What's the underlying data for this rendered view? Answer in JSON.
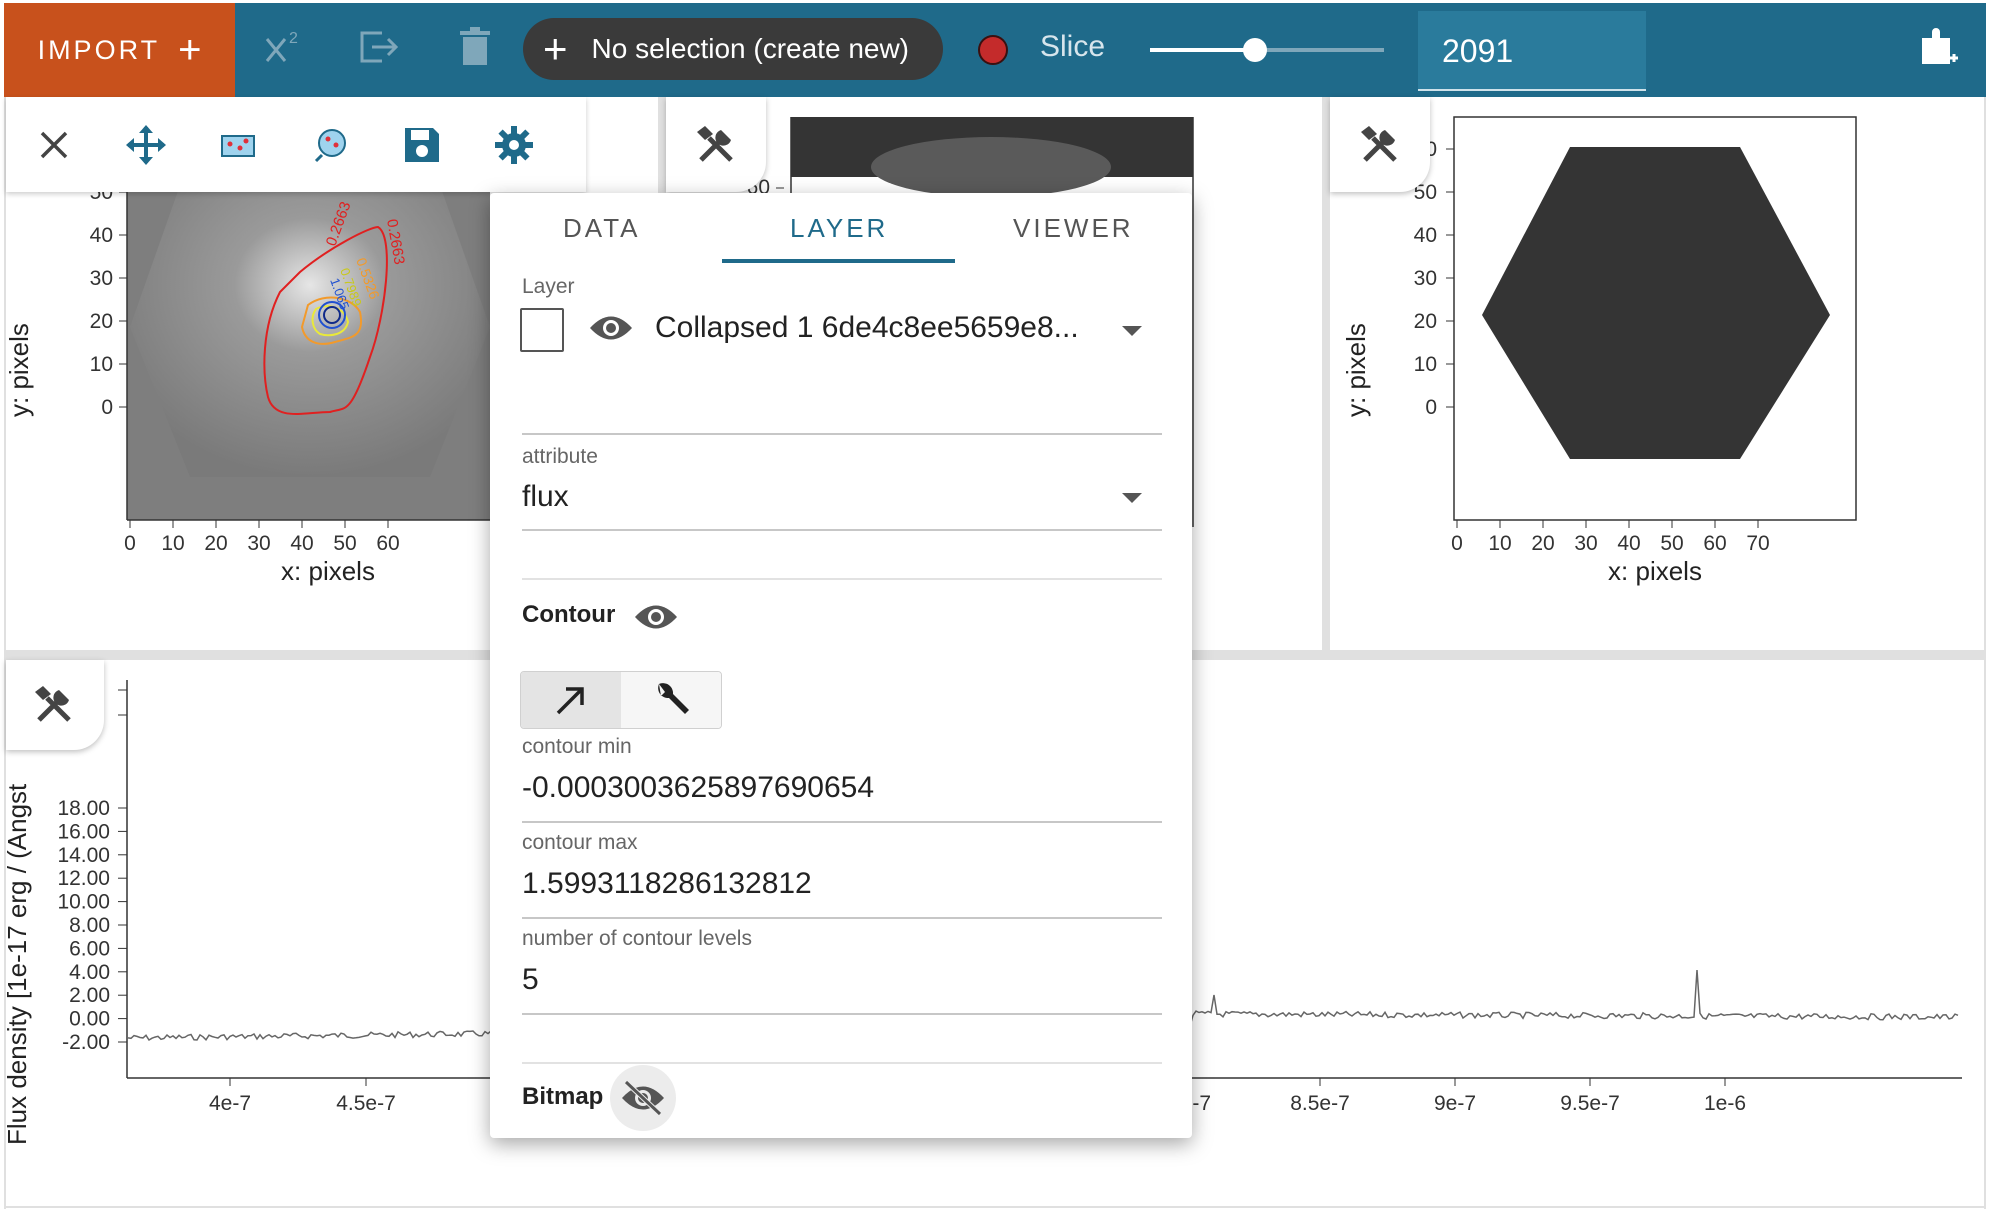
{
  "toolbar": {
    "import_label": "IMPORT",
    "subset_label": "No selection (create new)",
    "slice_label": "Slice",
    "slice_value": "2091",
    "slider_fraction": 0.45
  },
  "image_viewer_1": {
    "x_label": "x: pixels",
    "y_label": "y: pixels",
    "x_ticks": [
      "0",
      "10",
      "20",
      "30",
      "40",
      "50",
      "60"
    ],
    "y_ticks": [
      "0",
      "10",
      "20",
      "30",
      "40",
      "50"
    ],
    "contour_labels": [
      "0.2663",
      "0.2663",
      "0.5326",
      "0.7989",
      "1.065"
    ]
  },
  "image_viewer_2": {
    "y_ticks": [
      "60"
    ]
  },
  "image_viewer_3": {
    "x_label": "x: pixels",
    "y_label": "y: pixels",
    "x_ticks": [
      "0",
      "10",
      "20",
      "30",
      "40",
      "50",
      "60",
      "70"
    ],
    "y_ticks": [
      "0",
      "10",
      "20",
      "30",
      "40",
      "50",
      "60"
    ]
  },
  "spectrum_viewer": {
    "y_label": "Flux density [1e-17 erg / (Angst",
    "y_ticks": [
      "-2.00",
      "0.00",
      "2.00",
      "4.00",
      "6.00",
      "8.00",
      "10.00",
      "12.00",
      "14.00",
      "16.00",
      "18.00"
    ],
    "x_ticks": [
      "4e-7",
      "4.5e-7",
      "8e-7",
      "8.5e-7",
      "9e-7",
      "9.5e-7",
      "1e-6"
    ]
  },
  "popup": {
    "tabs": [
      "DATA",
      "LAYER",
      "VIEWER"
    ],
    "active_tab": "LAYER",
    "layer_label": "Layer",
    "layer_value": "Collapsed 1 6de4c8ee5659e8...",
    "attribute_label": "attribute",
    "attribute_value": "flux",
    "contour_title": "Contour",
    "contour_min_label": "contour min",
    "contour_min_value": "-0.0003003625897690654",
    "contour_max_label": "contour max",
    "contour_max_value": "1.5993118286132812",
    "levels_label": "number of contour levels",
    "levels_value": "5",
    "bitmap_title": "Bitmap"
  },
  "colors": {
    "toolbar_bg": "#1f6a8a",
    "import_bg": "#c8511c",
    "accent": "#1f6a8a",
    "contour_red": "#e02020"
  }
}
